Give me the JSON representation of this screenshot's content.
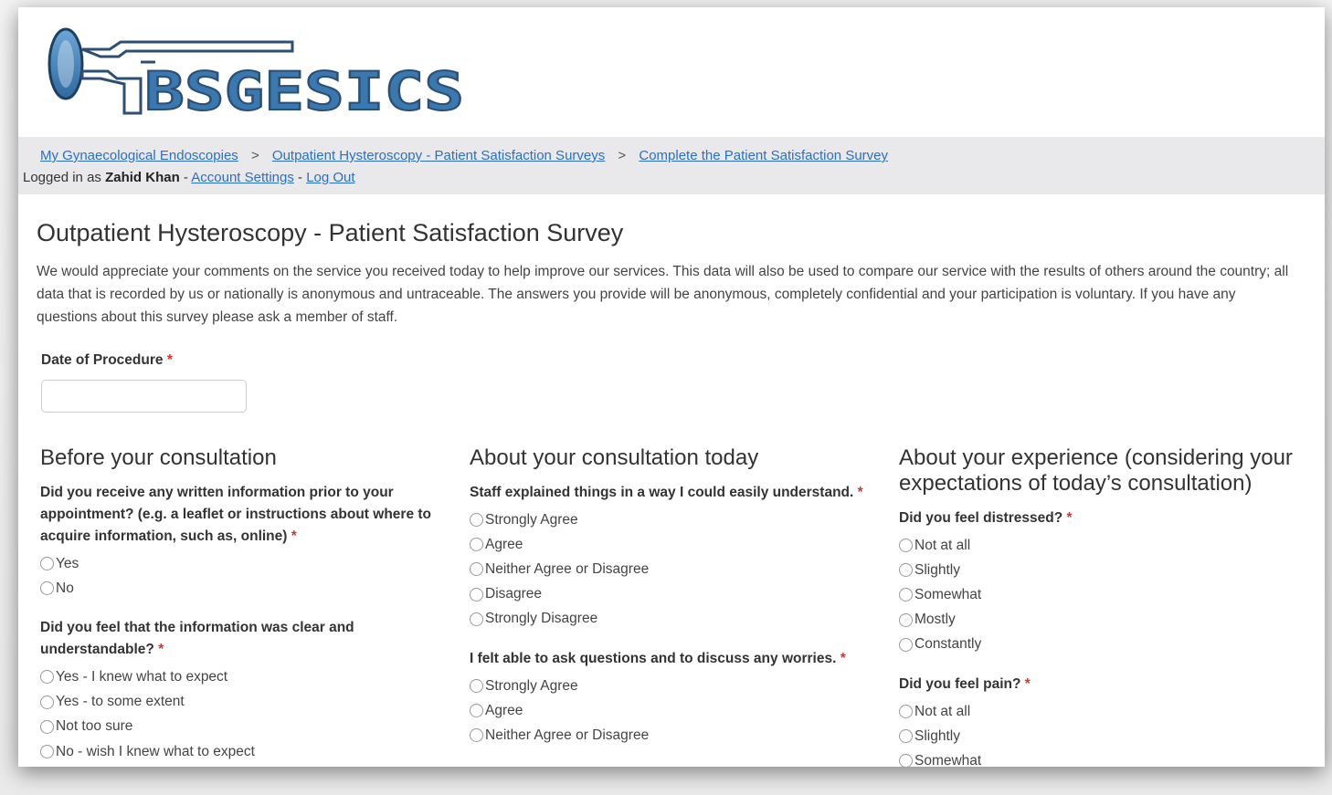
{
  "logo": {
    "text": "BSGESICS"
  },
  "breadcrumb": {
    "items": [
      "My Gynaecological Endoscopies",
      "Outpatient Hysteroscopy - Patient Satisfaction Surveys",
      "Complete the Patient Satisfaction Survey"
    ],
    "separator": ">"
  },
  "login": {
    "prefix": "Logged in as",
    "user": "Zahid Khan",
    "dash": "-",
    "account_settings": "Account Settings",
    "logout": "Log Out"
  },
  "page": {
    "title": "Outpatient Hysteroscopy - Patient Satisfaction Survey",
    "intro": "We would appreciate your comments on the service you received today to help improve our services. This data will also be used to compare our service with the results of others around the country; all data that is recorded by us or nationally is anonymous and untraceable. The answers you provide will be anonymous, completely confidential and your participation is voluntary. If you have any questions about this survey please ask a member of staff."
  },
  "date_field": {
    "label": "Date of Procedure",
    "required": "*",
    "value": ""
  },
  "sections": [
    {
      "title": "Before your consultation",
      "questions": [
        {
          "text": "Did you receive any written information prior to your appointment? (e.g. a leaflet or instructions about where to acquire information, such as, online)",
          "required": "*",
          "options": [
            "Yes",
            "No"
          ]
        },
        {
          "text": "Did you feel that the information was clear and understandable?",
          "required": "*",
          "options": [
            "Yes - I knew what to expect",
            "Yes - to some extent",
            "Not too sure",
            "No - wish I knew what to expect"
          ]
        }
      ]
    },
    {
      "title": "About your consultation today",
      "questions": [
        {
          "text": "Staff explained things in a way I could easily understand.",
          "required": "*",
          "options": [
            "Strongly Agree",
            "Agree",
            "Neither Agree or Disagree",
            "Disagree",
            "Strongly Disagree"
          ]
        },
        {
          "text": "I felt able to ask questions and to discuss any worries.",
          "required": "*",
          "options": [
            "Strongly Agree",
            "Agree",
            "Neither Agree or Disagree"
          ]
        }
      ]
    },
    {
      "title": "About your experience (considering your expectations of today’s consultation)",
      "questions": [
        {
          "text": "Did you feel distressed?",
          "required": "*",
          "options": [
            "Not at all",
            "Slightly",
            "Somewhat",
            "Mostly",
            "Constantly"
          ]
        },
        {
          "text": "Did you feel pain?",
          "required": "*",
          "options": [
            "Not at all",
            "Slightly",
            "Somewhat"
          ]
        }
      ]
    }
  ],
  "colors": {
    "link": "#2a6fc9",
    "required": "#d9342b",
    "crumb_bg": "#e9e9ec",
    "logo_blue": "#3a78b0",
    "logo_dark": "#2c4f73"
  }
}
